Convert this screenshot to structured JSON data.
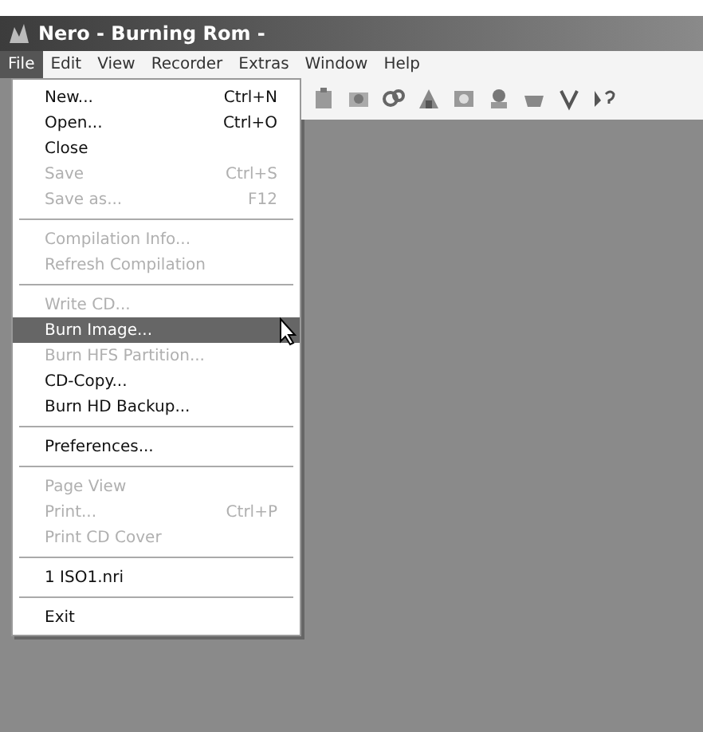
{
  "window": {
    "title": "Nero - Burning Rom -"
  },
  "menu_bar": [
    {
      "label": "File",
      "selected": true
    },
    {
      "label": "Edit",
      "selected": false
    },
    {
      "label": "View",
      "selected": false
    },
    {
      "label": "Recorder",
      "selected": false
    },
    {
      "label": "Extras",
      "selected": false
    },
    {
      "label": "Window",
      "selected": false
    },
    {
      "label": "Help",
      "selected": false
    }
  ],
  "file_menu": [
    {
      "kind": "item",
      "label": "New...",
      "shortcut": "Ctrl+N",
      "disabled": false,
      "selected": false
    },
    {
      "kind": "item",
      "label": "Open...",
      "shortcut": "Ctrl+O",
      "disabled": false,
      "selected": false
    },
    {
      "kind": "item",
      "label": "Close",
      "disabled": false,
      "selected": false
    },
    {
      "kind": "item",
      "label": "Save",
      "shortcut": "Ctrl+S",
      "disabled": true,
      "selected": false
    },
    {
      "kind": "item",
      "label": "Save as...",
      "shortcut": "F12",
      "disabled": true,
      "selected": false
    },
    {
      "kind": "separator"
    },
    {
      "kind": "item",
      "label": "Compilation Info...",
      "disabled": true,
      "selected": false
    },
    {
      "kind": "item",
      "label": "Refresh Compilation",
      "disabled": true,
      "selected": false
    },
    {
      "kind": "separator"
    },
    {
      "kind": "item",
      "label": "Write CD...",
      "disabled": true,
      "selected": false
    },
    {
      "kind": "item",
      "label": "Burn Image...",
      "disabled": false,
      "selected": true
    },
    {
      "kind": "item",
      "label": "Burn HFS Partition...",
      "disabled": true,
      "selected": false
    },
    {
      "kind": "item",
      "label": "CD-Copy...",
      "disabled": false,
      "selected": false
    },
    {
      "kind": "item",
      "label": "Burn HD Backup...",
      "disabled": false,
      "selected": false
    },
    {
      "kind": "separator"
    },
    {
      "kind": "item",
      "label": "Preferences...",
      "disabled": false,
      "selected": false
    },
    {
      "kind": "separator"
    },
    {
      "kind": "item",
      "label": "Page View",
      "disabled": true,
      "selected": false
    },
    {
      "kind": "item",
      "label": "Print...",
      "shortcut": "Ctrl+P",
      "disabled": true,
      "selected": false
    },
    {
      "kind": "item",
      "label": "Print CD Cover",
      "disabled": true,
      "selected": false
    },
    {
      "kind": "separator"
    },
    {
      "kind": "item",
      "label": "1 ISO1.nri",
      "disabled": false,
      "selected": false
    },
    {
      "kind": "separator"
    },
    {
      "kind": "item",
      "label": "Exit",
      "disabled": false,
      "selected": false
    }
  ]
}
